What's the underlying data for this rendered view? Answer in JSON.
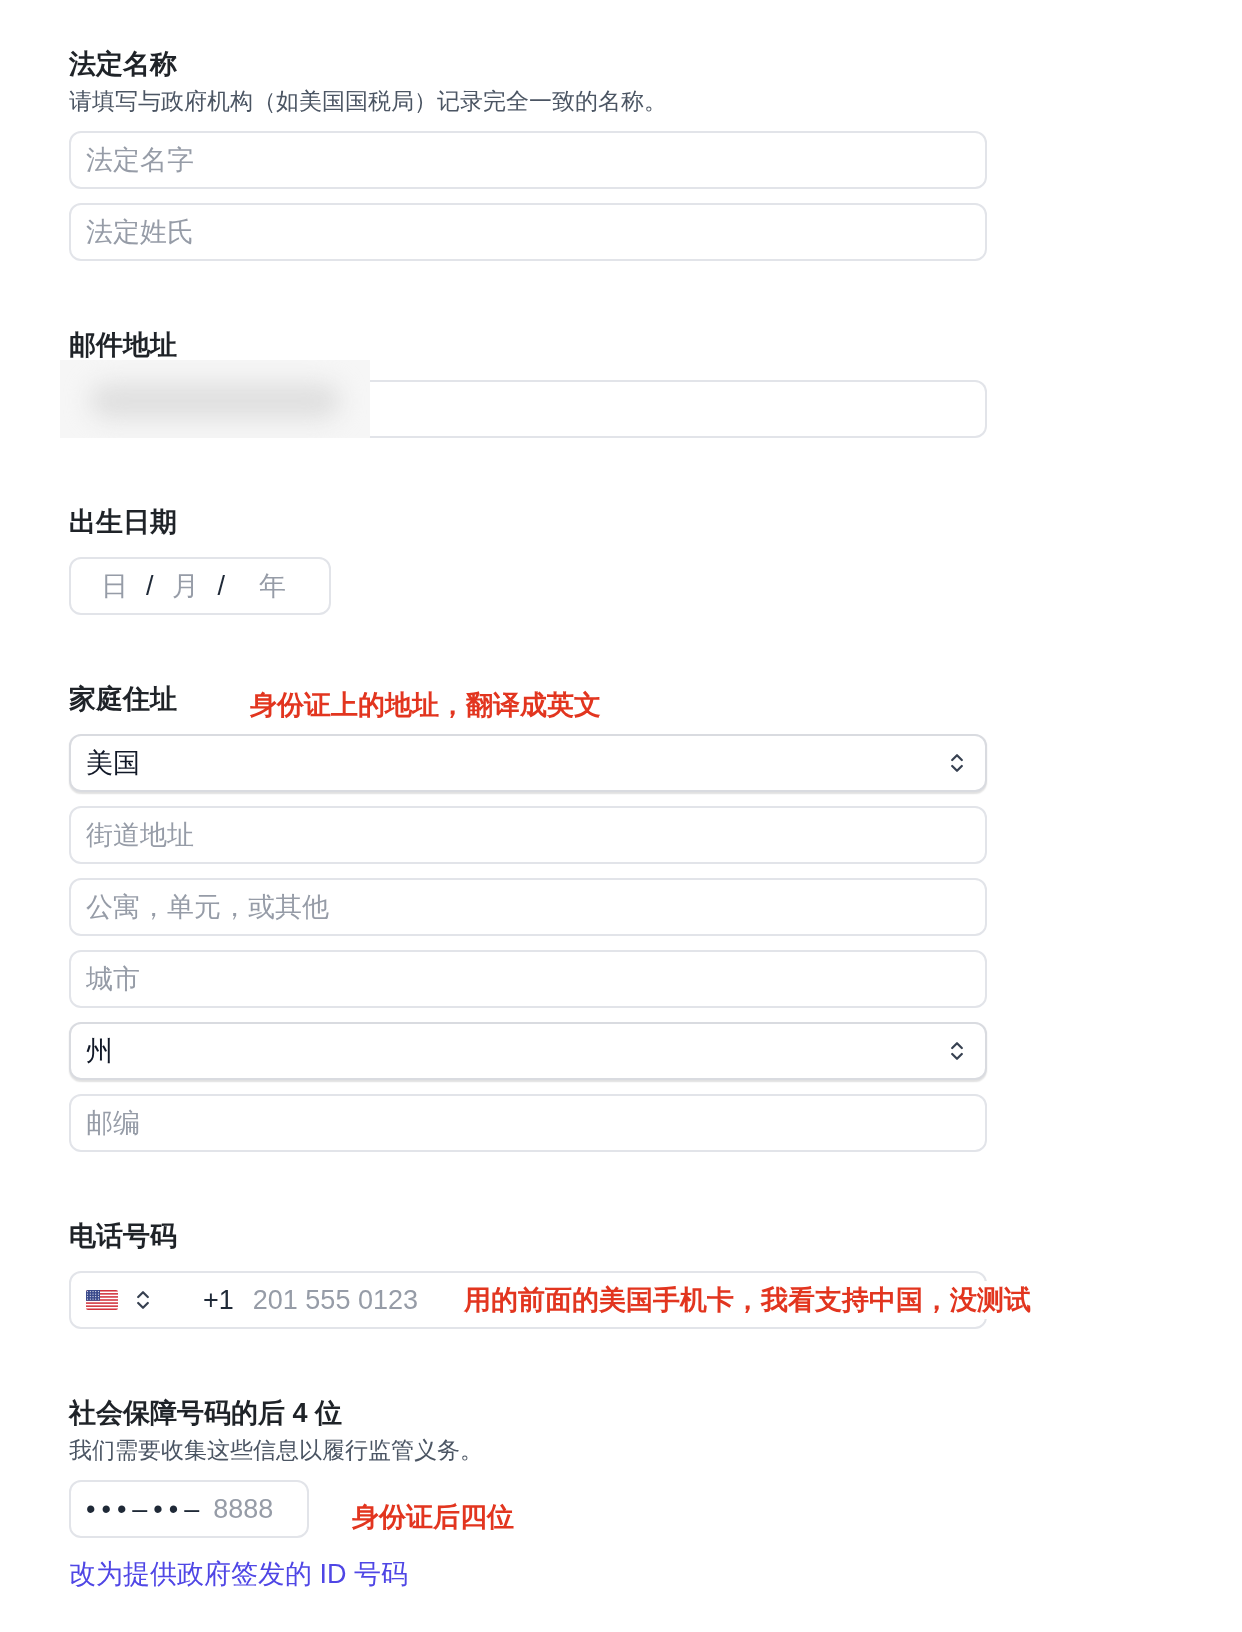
{
  "sections": [
    {
      "label": "法定名称",
      "description": "请填写与政府机构（如美国国税局）记录完全一致的名称。",
      "fields": [
        {
          "kind": "text",
          "placeholder": "法定名字"
        },
        {
          "kind": "text",
          "placeholder": "法定姓氏"
        }
      ]
    },
    {
      "label": "邮件地址",
      "fields": [
        {
          "kind": "text",
          "redacted": true
        }
      ]
    },
    {
      "label": "出生日期",
      "fields": [
        {
          "kind": "date",
          "parts": [
            {
              "placeholder": "日"
            },
            {
              "placeholder": "月"
            },
            {
              "placeholder": "年"
            }
          ],
          "separators": [
            "/",
            "/"
          ]
        }
      ]
    },
    {
      "label": "家庭住址",
      "note": "身份证上的地址，翻译成英文",
      "fields": [
        {
          "kind": "select",
          "value": "美国"
        },
        {
          "kind": "text",
          "placeholder": "街道地址"
        },
        {
          "kind": "text",
          "placeholder": "公寓，单元，或其他"
        },
        {
          "kind": "text",
          "placeholder": "城市"
        },
        {
          "kind": "select",
          "value": "州"
        },
        {
          "kind": "text",
          "placeholder": "邮编"
        }
      ]
    },
    {
      "label": "电话号码",
      "fields": [
        {
          "kind": "phone",
          "country_code": "+1",
          "placeholder": "201 555 0123",
          "note": "用的前面的美国手机卡，我看支持中国，没测试"
        }
      ]
    },
    {
      "label": "社会保障号码的后 4 位",
      "description": "我们需要收集这些信息以履行监管义务。",
      "fields": [
        {
          "kind": "ssn",
          "mask": "•••–••–",
          "placeholder": "8888",
          "note": "身份证后四位"
        }
      ],
      "link": "改为提供政府签发的 ID 号码"
    }
  ]
}
